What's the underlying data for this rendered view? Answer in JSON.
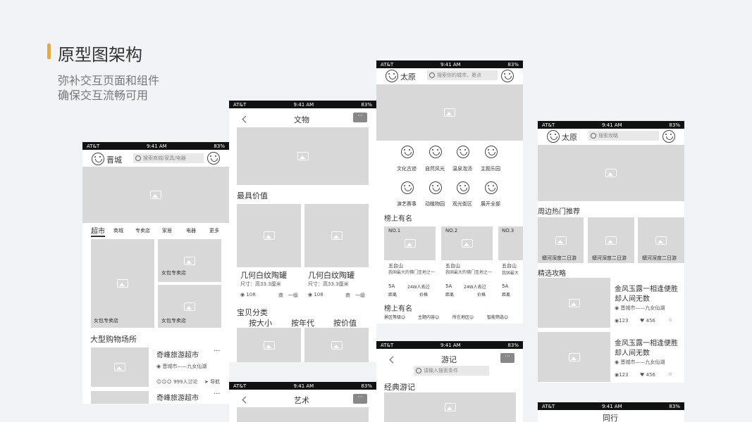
{
  "header": {
    "title": "原型图架构",
    "sub1": "弥补交互页面和组件",
    "sub2": "确保交互流畅可用"
  },
  "status": {
    "carrier": "AT&T",
    "time": "9:41 AM",
    "battery": "83%"
  },
  "p1": {
    "city": "晋城",
    "search": "搜索商城/家具/电器",
    "tabs": [
      "超市",
      "商城",
      "专卖店",
      "家居",
      "电器",
      "更多"
    ],
    "cap1": "女包专卖店",
    "cap2": "女包专卖店",
    "cap3": "女包专卖店",
    "section": "大型购物场所",
    "shop_name": "奇峰旅游超市",
    "shop_loc": "晋城市——九女仙湖",
    "discuss": "999人讨论",
    "nav": "导航",
    "shop_name2": "奇峰旅游超市"
  },
  "p2": {
    "title": "文物",
    "section1": "最具价值",
    "item1": "几何白纹陶罐",
    "item2": "几何白纹陶罐",
    "size1": "尺寸：高33.3厘米",
    "size2": "尺寸：高33.3厘米",
    "views1": "108",
    "views2": "108",
    "grade1": "商　一级",
    "grade2": "商　一级",
    "section2": "宝贝分类",
    "sort": [
      "按大小",
      "按年代",
      "按价值"
    ]
  },
  "p3": {
    "title": "艺术"
  },
  "p4": {
    "city": "太原",
    "search": "搜索你的城市、景点",
    "cats": [
      "文化古迹",
      "自然风光",
      "温泉泡汤",
      "主题乐园",
      "演艺赛事",
      "动植物园",
      "观光街区",
      "展开全部"
    ],
    "rank": "榜上有名",
    "no1": "NO.1",
    "no2": "NO.2",
    "no3": "NO.3",
    "spot": "五台山",
    "desc1": "我国最大的佛门圣地之一",
    "desc3": "我国最大",
    "level": "5A",
    "visitors": "24W人去过",
    "dist": "距离",
    "price": "价格",
    "rank2": "榜上有名",
    "filters": [
      "景区等级",
      "主题内容",
      "所在地区",
      "智能筛选"
    ]
  },
  "p5": {
    "title": "游记",
    "search": "请输入搜索条件",
    "section": "经典游记"
  },
  "p6": {
    "city": "太原",
    "search": "搜索攻略",
    "section1": "周边热门推荐",
    "trip": "蟒河深度二日游",
    "section2": "精选攻略",
    "g_title1": "金风玉露一相逢便胜",
    "g_title2": "却人间无数",
    "g_loc": "晋城市——九女仙湖",
    "views": "123",
    "likes": "456"
  },
  "p7": {
    "title": "同行"
  }
}
